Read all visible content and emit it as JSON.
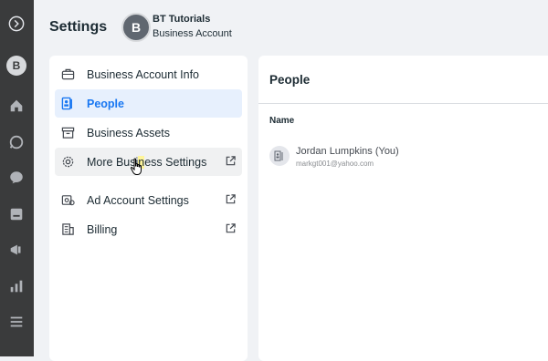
{
  "header": {
    "title": "Settings",
    "avatar_letter": "B",
    "business_name": "BT Tutorials",
    "account_type": "Business Account"
  },
  "rail": {
    "avatar_letter": "B",
    "icons": [
      "collapse-icon",
      "home-icon",
      "whatsapp-icon",
      "messenger-icon",
      "pages-icon",
      "megaphone-icon",
      "insights-icon",
      "menu-icon"
    ]
  },
  "nav": {
    "items": [
      {
        "label": "Business Account Info",
        "icon": "briefcase-icon",
        "external": false,
        "state": "normal"
      },
      {
        "label": "People",
        "icon": "people-icon",
        "external": false,
        "state": "active"
      },
      {
        "label": "Business Assets",
        "icon": "archive-icon",
        "external": false,
        "state": "normal"
      },
      {
        "label_parts": [
          "More Busi",
          "n",
          "ess Settings"
        ],
        "icon": "gear-icon",
        "external": true,
        "state": "hover"
      },
      {
        "label": "Ad Account Settings",
        "icon": "ad-account-icon",
        "external": true,
        "state": "normal"
      },
      {
        "label": "Billing",
        "icon": "billing-icon",
        "external": true,
        "state": "normal"
      }
    ]
  },
  "people": {
    "title": "People",
    "column_header": "Name",
    "rows": [
      {
        "name": "Jordan Lumpkins (You)",
        "email": "markgt001@yahoo.com"
      }
    ]
  },
  "colors": {
    "accent": "#1877f2",
    "rail": "#3a3b3c",
    "background": "#f0f2f5"
  }
}
